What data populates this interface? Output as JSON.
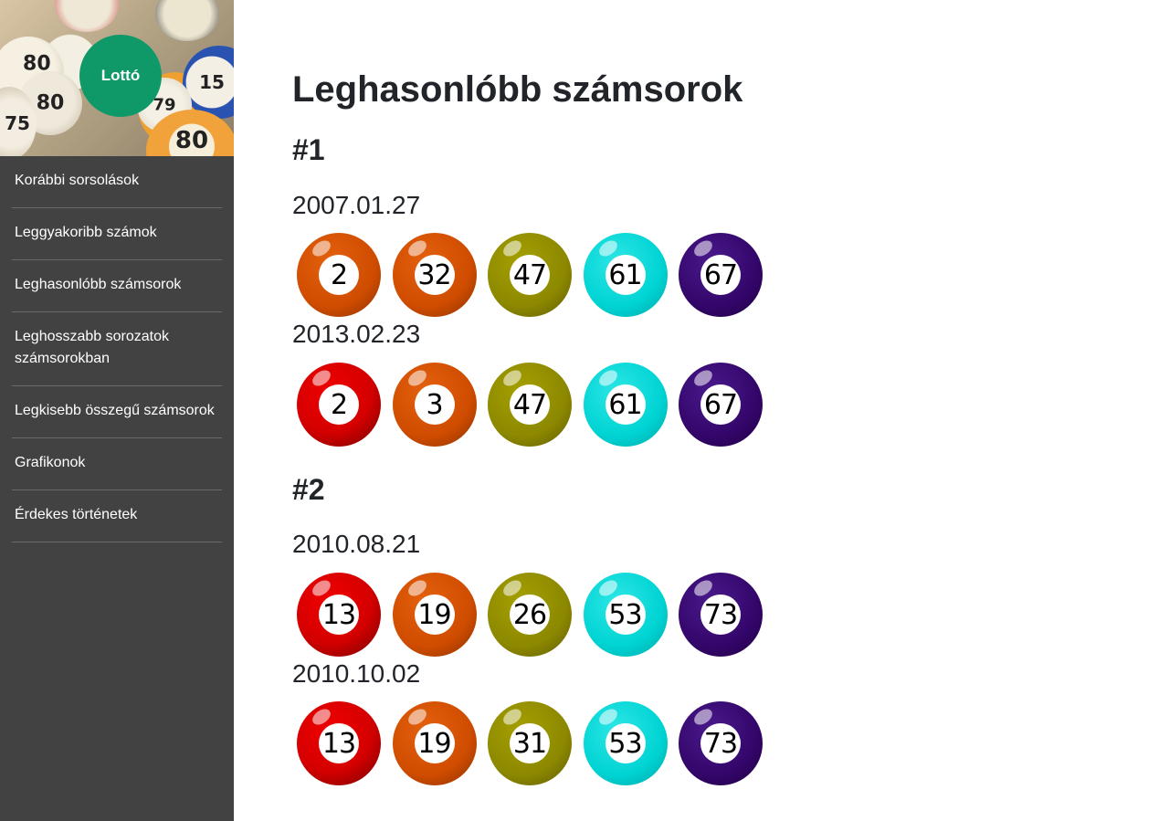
{
  "logo": {
    "label": "Lottó"
  },
  "banner": {
    "visible_numbers": [
      "80",
      "80",
      "75",
      "15",
      "79",
      "80"
    ]
  },
  "nav": {
    "items": [
      {
        "label": "Korábbi sorsolások"
      },
      {
        "label": "Leggyakoribb számok"
      },
      {
        "label": "Leghasonlóbb számsorok"
      },
      {
        "label": "Leghosszabb sorozatok számsorokban"
      },
      {
        "label": "Legkisebb összegű számsorok"
      },
      {
        "label": "Grafikonok"
      },
      {
        "label": "Érdekes történetek"
      }
    ]
  },
  "main": {
    "title": "Leghasonlóbb számsorok",
    "groups": [
      {
        "heading": "#1",
        "draws": [
          {
            "date": "2007.01.27",
            "numbers": [
              "2",
              "32",
              "47",
              "61",
              "67"
            ],
            "colors": [
              "orange",
              "orange",
              "olive",
              "cyan",
              "purple"
            ]
          },
          {
            "date": "2013.02.23",
            "numbers": [
              "2",
              "3",
              "47",
              "61",
              "67"
            ],
            "colors": [
              "red",
              "orange",
              "olive",
              "cyan",
              "purple"
            ]
          }
        ]
      },
      {
        "heading": "#2",
        "draws": [
          {
            "date": "2010.08.21",
            "numbers": [
              "13",
              "19",
              "26",
              "53",
              "73"
            ],
            "colors": [
              "red",
              "orange",
              "olive",
              "cyan",
              "purple"
            ]
          },
          {
            "date": "2010.10.02",
            "numbers": [
              "13",
              "19",
              "31",
              "53",
              "73"
            ],
            "colors": [
              "red",
              "orange",
              "olive",
              "cyan",
              "purple"
            ]
          }
        ]
      }
    ]
  },
  "colors": {
    "sidebar_bg": "#424242",
    "logo_bg": "#0f9968",
    "red": "#d40000",
    "orange": "#cf4c00",
    "olive": "#8c8800",
    "cyan": "#00d3d3",
    "purple": "#33066a"
  }
}
